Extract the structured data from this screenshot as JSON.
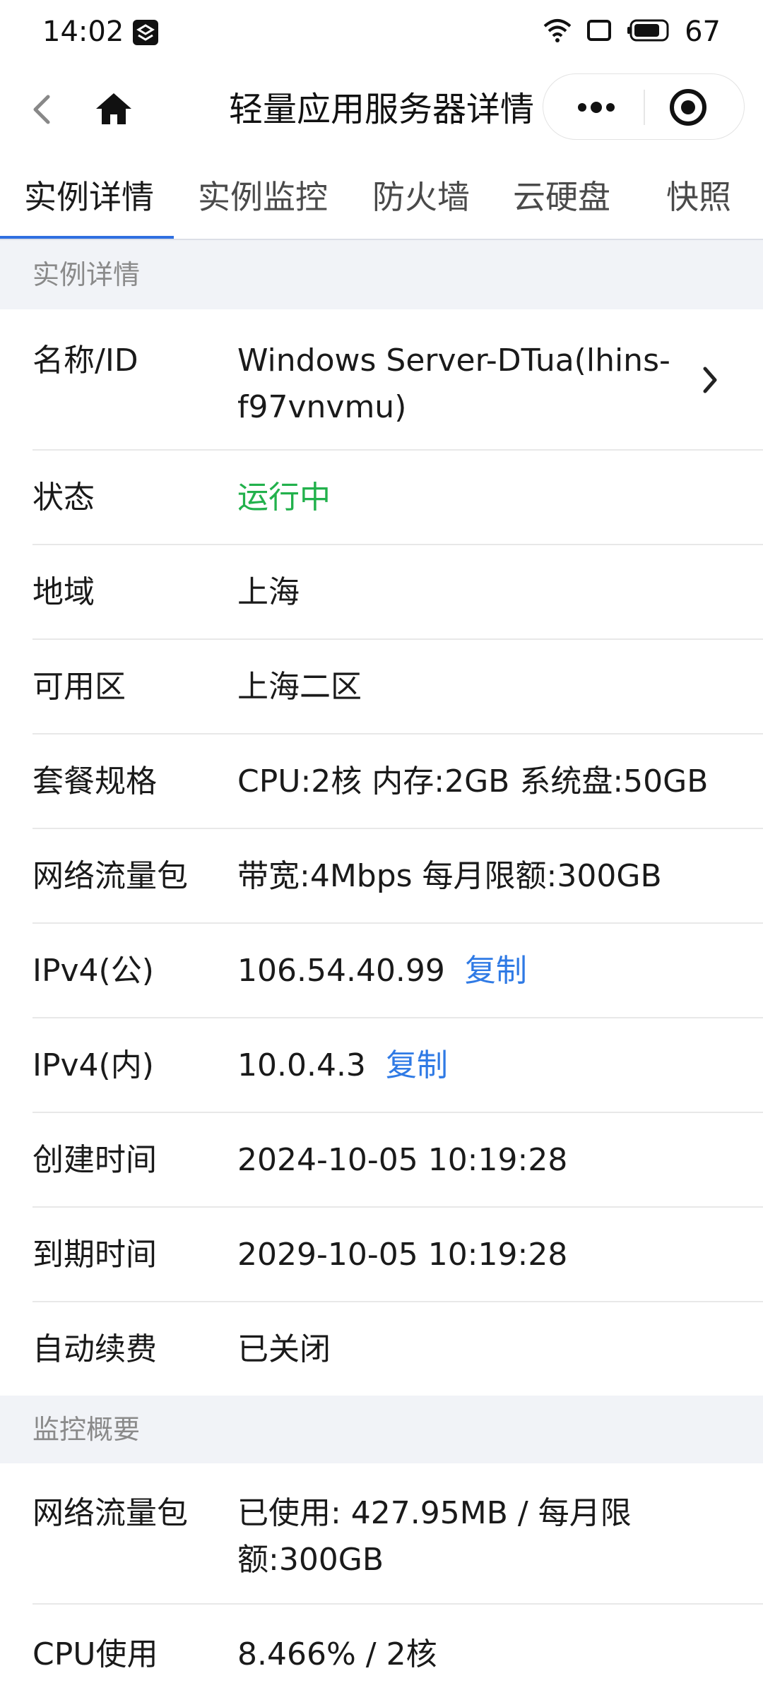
{
  "status_bar": {
    "time": "14:02",
    "battery": "67",
    "icons": [
      "app-notification-icon",
      "wifi-icon",
      "screen-cast-icon",
      "battery-icon"
    ]
  },
  "nav": {
    "title": "轻量应用服务器详情",
    "icons": [
      "back-icon",
      "home-icon",
      "more-icon",
      "close-mini-program-icon"
    ]
  },
  "tabs": [
    {
      "label": "实例详情",
      "active": true
    },
    {
      "label": "实例监控",
      "active": false
    },
    {
      "label": "防火墙",
      "active": false
    },
    {
      "label": "云硬盘",
      "active": false
    },
    {
      "label": "快照",
      "active": false
    }
  ],
  "colors": {
    "accent": "#2f6fe0",
    "link": "#2f7ae5",
    "running": "#22b14c",
    "section_bg": "#f1f3f7"
  },
  "instance_details": {
    "section_title": "实例详情",
    "name_id": {
      "label": "名称/ID",
      "value_line1": "Windows Server-DTua(lhins-",
      "value_line2": "f97vnvmu)"
    },
    "status": {
      "label": "状态",
      "value": "运行中"
    },
    "region": {
      "label": "地域",
      "value": "上海"
    },
    "zone": {
      "label": "可用区",
      "value": "上海二区"
    },
    "plan": {
      "label": "套餐规格",
      "value": "CPU:2核 内存:2GB 系统盘:50GB"
    },
    "traffic": {
      "label": "网络流量包",
      "value": "带宽:4Mbps 每月限额:300GB"
    },
    "ipv4_public": {
      "label": "IPv4(公)",
      "value": "106.54.40.99",
      "copy": "复制"
    },
    "ipv4_private": {
      "label": "IPv4(内)",
      "value": "10.0.4.3",
      "copy": "复制"
    },
    "created": {
      "label": "创建时间",
      "value": "2024-10-05 10:19:28"
    },
    "expires": {
      "label": "到期时间",
      "value": "2029-10-05 10:19:28"
    },
    "auto_renew": {
      "label": "自动续费",
      "value": "已关闭"
    }
  },
  "monitoring_summary": {
    "section_title": "监控概要",
    "traffic": {
      "label": "网络流量包",
      "value_line1": "已使用: 427.95MB / 每月限",
      "value_line2": "额:300GB"
    },
    "cpu": {
      "label": "CPU使用",
      "value": "8.466% / 2核"
    }
  }
}
